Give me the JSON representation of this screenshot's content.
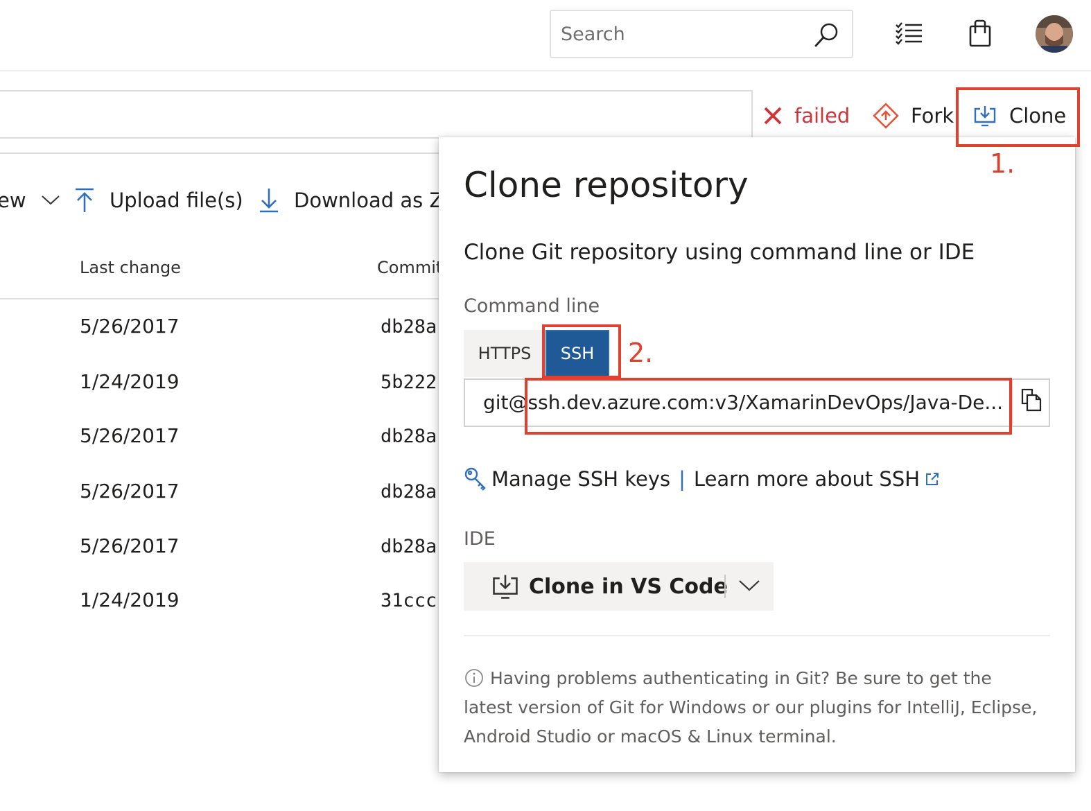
{
  "header": {
    "search_placeholder": "Search",
    "icons": [
      "search-icon",
      "task-list-icon",
      "shopping-bag-icon",
      "avatar"
    ]
  },
  "repo_actions": {
    "status_label": "failed",
    "fork_label": "Fork",
    "clone_label": "Clone"
  },
  "toolbar": {
    "view_label": "ew",
    "upload_label": "Upload file(s)",
    "download_label": "Download as Zi"
  },
  "table": {
    "columns": [
      "Last change",
      "Commit"
    ],
    "rows": [
      {
        "date": "5/26/2017",
        "commit": "db28a"
      },
      {
        "date": "1/24/2019",
        "commit": "5b222"
      },
      {
        "date": "5/26/2017",
        "commit": "db28a"
      },
      {
        "date": "5/26/2017",
        "commit": "db28a"
      },
      {
        "date": "5/26/2017",
        "commit": "db28a"
      },
      {
        "date": "1/24/2019",
        "commit": "31ccc"
      }
    ]
  },
  "clone_panel": {
    "title": "Clone repository",
    "subtitle": "Clone Git repository using command line or IDE",
    "command_line_label": "Command line",
    "tabs": [
      {
        "label": "HTTPS",
        "selected": false
      },
      {
        "label": "SSH",
        "selected": true
      }
    ],
    "url": "git@ssh.dev.azure.com:v3/XamarinDevOps/Java-De...",
    "manage_keys_label": "Manage SSH keys",
    "separator": "|",
    "learn_more_label": "Learn more about SSH",
    "ide_label": "IDE",
    "ide_button_label": "Clone in VS Code",
    "note": "Having problems authenticating in Git? Be sure to get the latest version of Git for Windows or our plugins for IntelliJ, Eclipse, Android Studio or macOS & Linux terminal."
  },
  "annotations": {
    "step1": "1.",
    "step2": "2."
  },
  "colors": {
    "accent_blue": "#1f5a96",
    "link_blue": "#2f6fba",
    "error_red": "#d13438",
    "annotation_red": "#e0402e"
  }
}
